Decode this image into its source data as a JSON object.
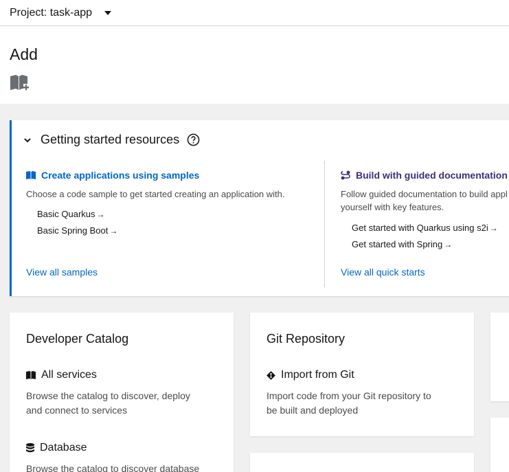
{
  "topbar": {
    "project_label": "Project: task-app"
  },
  "page": {
    "title": "Add"
  },
  "getting_started": {
    "title": "Getting started resources",
    "samples": {
      "title": "Create applications using samples",
      "description": "Choose a code sample to get started creating an application with.",
      "links": [
        "Basic Quarkus",
        "Basic Spring Boot"
      ],
      "view_all": "View all samples"
    },
    "quickstarts": {
      "title": "Build with guided documentation",
      "description_line1": "Follow guided documentation to build appl",
      "description_line2": "yourself with key features.",
      "links": [
        "Get started with Quarkus using s2i",
        "Get started with Spring"
      ],
      "view_all": "View all quick starts"
    },
    "arrow_glyph": "→"
  },
  "developer_catalog": {
    "title": "Developer Catalog",
    "all_services": {
      "title": "All services",
      "description_line1": "Browse the catalog to discover, deploy",
      "description_line2": "and connect to services"
    },
    "database": {
      "title": "Database",
      "description_line1": "Browse the catalog to discover database"
    }
  },
  "git_repository": {
    "title": "Git Repository",
    "import_from_git": {
      "title": "Import from Git",
      "description_line1": "Import code from your Git repository to",
      "description_line2": "be built and deployed"
    }
  },
  "colors": {
    "link": "#0066cc",
    "accent_purple": "#3c2d7c",
    "left_border": "#0066cc"
  }
}
